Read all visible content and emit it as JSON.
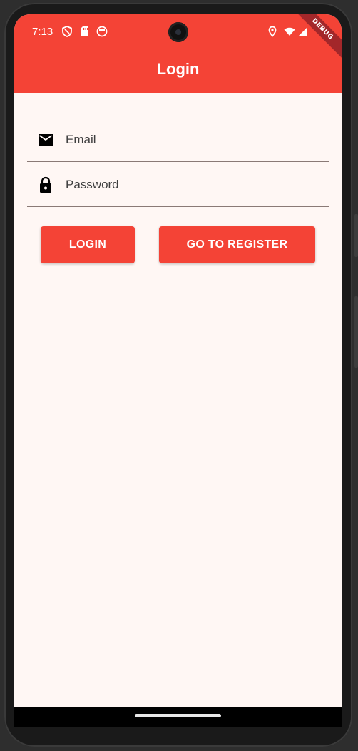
{
  "status_bar": {
    "time": "7:13",
    "icons_left": [
      "shield-icon",
      "sd-card-icon",
      "app-notification-icon"
    ],
    "icons_right": [
      "location-icon",
      "wifi-icon",
      "signal-icon"
    ]
  },
  "debug_banner": "DEBUG",
  "app_bar": {
    "title": "Login",
    "color": "#f44336"
  },
  "form": {
    "email": {
      "placeholder": "Email",
      "value": "",
      "icon": "mail-icon"
    },
    "password": {
      "placeholder": "Password",
      "value": "",
      "icon": "lock-icon"
    }
  },
  "buttons": {
    "login_label": "LOGIN",
    "register_label": "GO TO REGISTER"
  },
  "colors": {
    "accent": "#f44336",
    "background": "#fff7f4"
  }
}
